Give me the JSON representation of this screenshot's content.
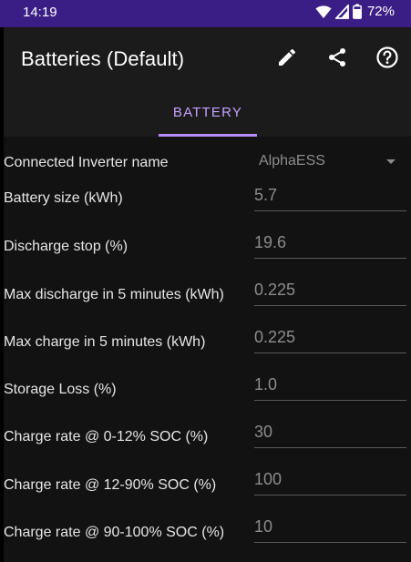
{
  "status_bar": {
    "time": "14:19",
    "battery_percent": "72%"
  },
  "app_bar": {
    "title": "Batteries (Default)",
    "icons": [
      "edit-icon",
      "share-icon",
      "help-icon"
    ]
  },
  "tabs": [
    {
      "label": "BATTERY",
      "selected": true
    }
  ],
  "colors": {
    "status_bar": "#3a1e86",
    "accent": "#b58cff",
    "background": "#121212"
  },
  "form": {
    "inverter": {
      "label": "Connected Inverter name",
      "value": "AlphaESS"
    },
    "fields": [
      {
        "label": "Battery size (kWh)",
        "value": "5.7"
      },
      {
        "label": "Discharge stop (%)",
        "value": "19.6"
      },
      {
        "label": "Max discharge in 5 minutes (kWh)",
        "value": "0.225"
      },
      {
        "label": "Max charge in 5 minutes (kWh)",
        "value": "0.225"
      },
      {
        "label": "Storage Loss (%)",
        "value": "1.0"
      },
      {
        "label": "Charge rate @ 0-12% SOC (%)",
        "value": "30"
      },
      {
        "label": "Charge rate @ 12-90% SOC (%)",
        "value": "100"
      },
      {
        "label": "Charge rate @ 90-100% SOC (%)",
        "value": "10"
      }
    ]
  }
}
